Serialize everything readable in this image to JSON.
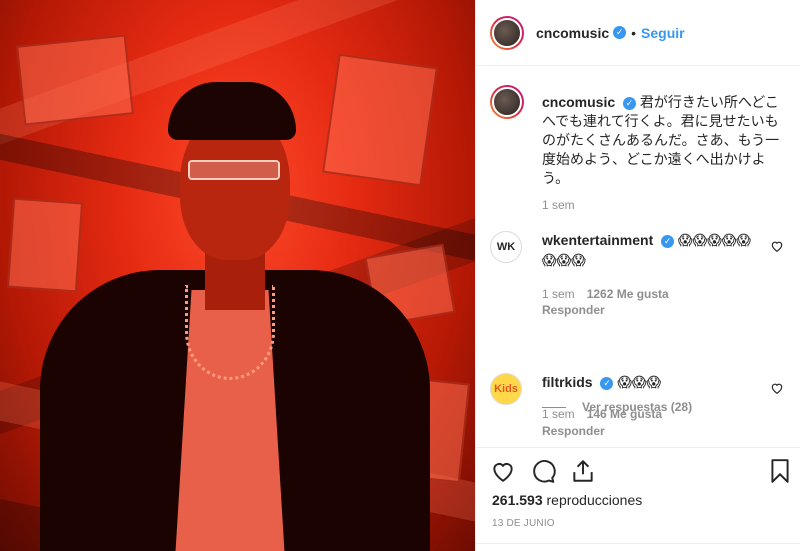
{
  "post": {
    "username": "cncomusic",
    "dot": "•",
    "follow_label": "Seguir",
    "caption_text": "君が行きたい所へどこへでも連れて行くよ。君に見せたいものがたくさんあるんだ。さあ、もう一度始めよう、どこか遠くへ出かけよう。",
    "caption_time": "1 sem",
    "views_count": "261.593",
    "views_label": "reproducciones",
    "date": "13 DE JUNIO"
  },
  "comments": [
    {
      "username": "wkentertainment",
      "text": "😱😱😱😱😱😱😱😱",
      "time": "1 sem",
      "likes": "1262 Me gusta",
      "reply_label": "Responder",
      "avatar_text": "WK",
      "view_replies": "Ver respuestas (28)"
    },
    {
      "username": "filtrkids",
      "text": "😱😱😱",
      "time": "1 sem",
      "likes": "146 Me gusta",
      "reply_label": "Responder",
      "avatar_text": "Kids"
    }
  ],
  "icons": {
    "verified": "verified-badge-icon",
    "like": "heart-icon",
    "comment": "comment-icon",
    "share": "share-icon",
    "save": "bookmark-icon"
  },
  "colors": {
    "accent": "#3897f0",
    "muted": "#8e8e8e",
    "text": "#262626"
  }
}
